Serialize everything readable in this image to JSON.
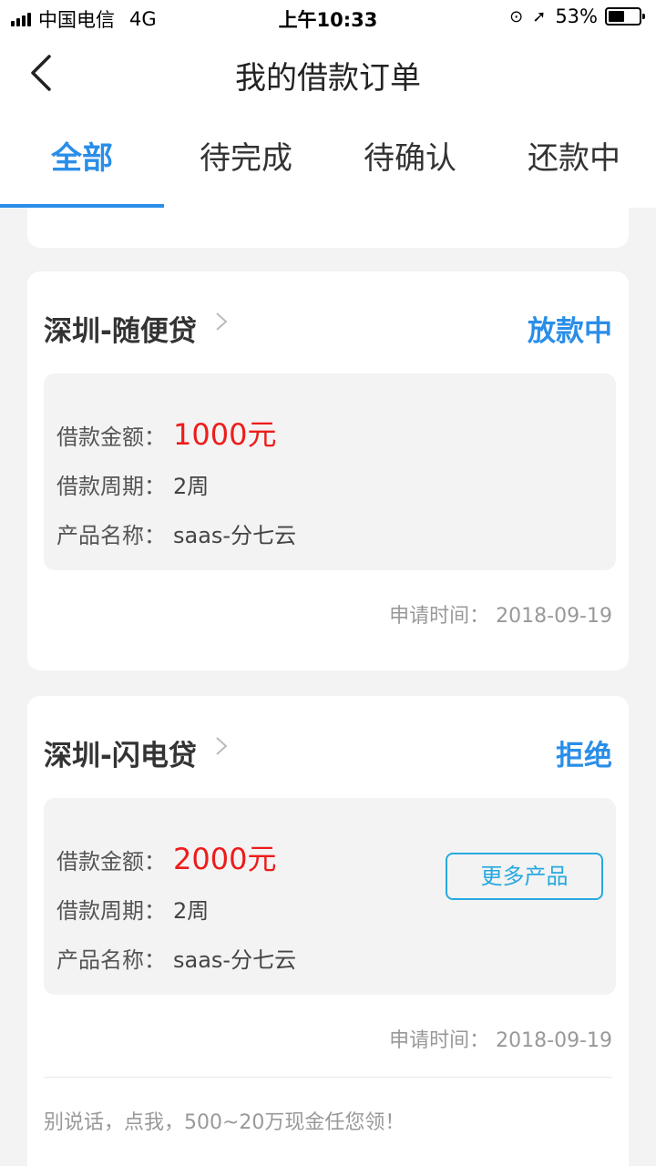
{
  "status_bar": {
    "carrier": "中国电信",
    "network": "4G",
    "time": "上午10:33",
    "battery": "53%",
    "battery_level": 0.53
  },
  "nav": {
    "title": "我的借款订单"
  },
  "tabs": [
    {
      "label": "全部",
      "active": true
    },
    {
      "label": "待完成",
      "active": false
    },
    {
      "label": "待确认",
      "active": false
    },
    {
      "label": "还款中",
      "active": false
    }
  ],
  "orders": [
    {
      "product": "深圳-随便贷",
      "status": "放款中",
      "amount_label": "借款金额：",
      "amount": "1000元",
      "period_label": "借款周期：",
      "period": "2周",
      "name_label": "产品名称：",
      "name": "saas-分七云",
      "apply_label": "申请时间：",
      "apply_date": "2018-09-19"
    },
    {
      "product": "深圳-闪电贷",
      "status": "拒绝",
      "amount_label": "借款金额：",
      "amount": "2000元",
      "period_label": "借款周期：",
      "period": "2周",
      "name_label": "产品名称：",
      "name": "saas-分七云",
      "apply_label": "申请时间：",
      "apply_date": "2018-09-19",
      "more_button": "更多产品",
      "promo": "别说话，点我，500~20万现金任您领！"
    }
  ],
  "colors": {
    "accent": "#2a8ee8",
    "amount": "#ee1c1c",
    "button_border": "#27a9e0",
    "background": "#f3f3f3"
  }
}
